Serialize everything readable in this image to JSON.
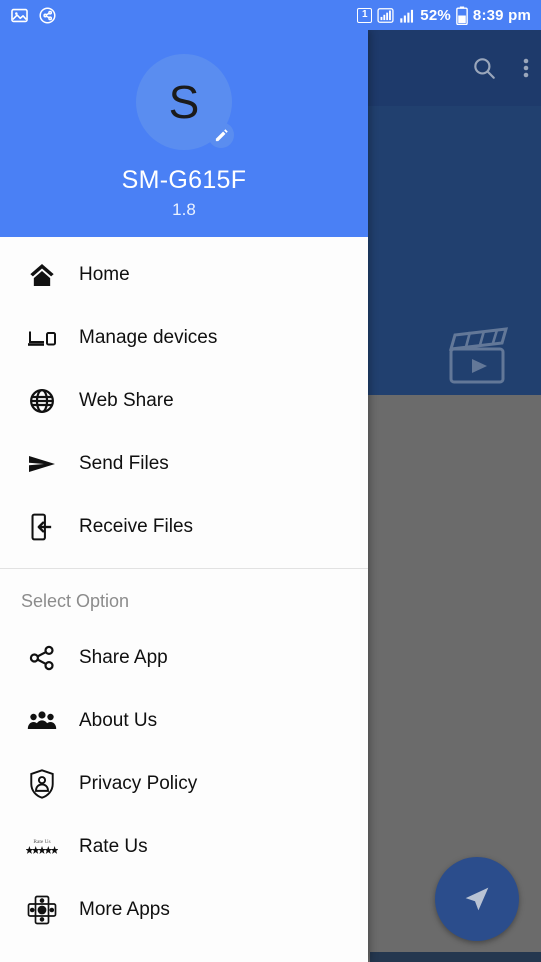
{
  "status_bar": {
    "left_icons": [
      "image-icon",
      "share-circle-icon"
    ],
    "notification_count": "1",
    "battery_percent": "52%",
    "time": "8:39 pm",
    "background_color": "#4a80f5"
  },
  "background_app": {
    "appbar_color": "#1e3a6b",
    "content_color": "#21406f",
    "lower_color": "#6b6b6b",
    "icons": [
      "search-icon",
      "overflow-menu-icon"
    ],
    "placeholder_icon": "clapperboard-icon",
    "fab": {
      "icon": "send-icon",
      "color": "#2b4d8c"
    }
  },
  "drawer": {
    "header": {
      "avatar_initial": "S",
      "edit_icon": "pencil-icon",
      "device_name": "SM-G615F",
      "version": "1.8",
      "background_color": "#4a80f5"
    },
    "primary_items": [
      {
        "label": "Home",
        "icon": "home-icon"
      },
      {
        "label": "Manage devices",
        "icon": "devices-icon"
      },
      {
        "label": "Web Share",
        "icon": "globe-icon"
      },
      {
        "label": "Send Files",
        "icon": "send-icon"
      },
      {
        "label": "Receive Files",
        "icon": "receive-icon"
      }
    ],
    "section_title": "Select Option",
    "secondary_items": [
      {
        "label": "Share App",
        "icon": "share-nodes-icon"
      },
      {
        "label": "About Us",
        "icon": "people-icon"
      },
      {
        "label": "Privacy Policy",
        "icon": "shield-user-icon"
      },
      {
        "label": "Rate Us",
        "icon": "stars-icon"
      },
      {
        "label": "More Apps",
        "icon": "apps-grid-icon"
      }
    ]
  }
}
